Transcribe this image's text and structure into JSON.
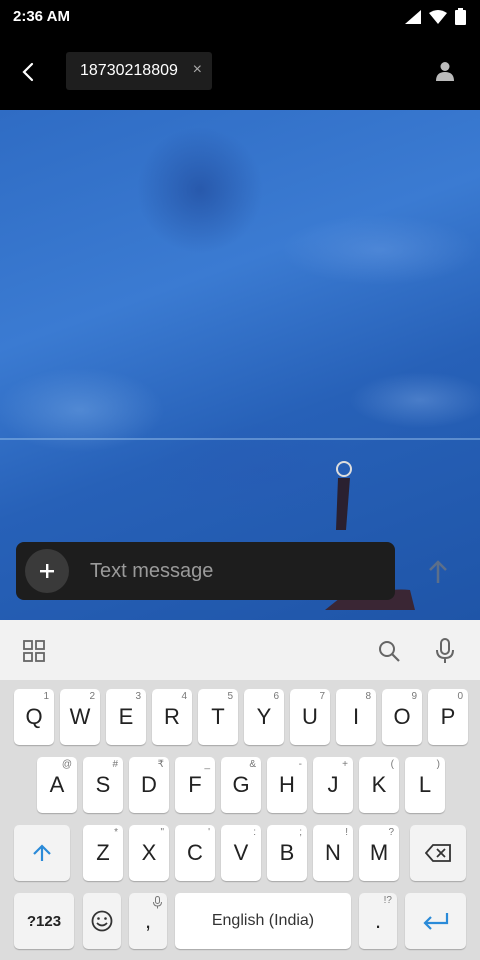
{
  "status_bar": {
    "time": "2:36 AM"
  },
  "header": {
    "recipient": "18730218809",
    "remove_glyph": "×",
    "icons": {
      "back": "back-arrow-icon",
      "contact": "person-icon"
    }
  },
  "compose": {
    "placeholder": "Text message",
    "attach_glyph": "+",
    "icons": {
      "attach": "plus-icon",
      "send": "send-arrow-icon"
    }
  },
  "keyboard_toolbar": {
    "icons": [
      "grid-icon",
      "search-icon",
      "mic-icon"
    ]
  },
  "keyboard": {
    "row1": [
      {
        "label": "Q",
        "hint": "1"
      },
      {
        "label": "W",
        "hint": "2"
      },
      {
        "label": "E",
        "hint": "3"
      },
      {
        "label": "R",
        "hint": "4"
      },
      {
        "label": "T",
        "hint": "5"
      },
      {
        "label": "Y",
        "hint": "6"
      },
      {
        "label": "U",
        "hint": "7"
      },
      {
        "label": "I",
        "hint": "8"
      },
      {
        "label": "O",
        "hint": "9"
      },
      {
        "label": "P",
        "hint": "0"
      }
    ],
    "row2": [
      {
        "label": "A",
        "hint": "@"
      },
      {
        "label": "S",
        "hint": "#"
      },
      {
        "label": "D",
        "hint": "₹"
      },
      {
        "label": "F",
        "hint": "_"
      },
      {
        "label": "G",
        "hint": "&"
      },
      {
        "label": "H",
        "hint": "-"
      },
      {
        "label": "J",
        "hint": "+"
      },
      {
        "label": "K",
        "hint": "("
      },
      {
        "label": "L",
        "hint": ")"
      }
    ],
    "row3": [
      {
        "label": "Z",
        "hint": "*"
      },
      {
        "label": "X",
        "hint": "\""
      },
      {
        "label": "C",
        "hint": "'"
      },
      {
        "label": "V",
        "hint": ":"
      },
      {
        "label": "B",
        "hint": ";"
      },
      {
        "label": "N",
        "hint": "!"
      },
      {
        "label": "M",
        "hint": "?"
      }
    ],
    "symbols_label": "?123",
    "comma_label": ",",
    "space_label": "English (India)",
    "period_label": ".",
    "period_hint": "!?",
    "icons": {
      "shift": "shift-arrow-icon",
      "backspace": "backspace-icon",
      "emoji": "emoji-icon",
      "comma_mic": "mic-icon",
      "enter": "enter-icon"
    }
  }
}
